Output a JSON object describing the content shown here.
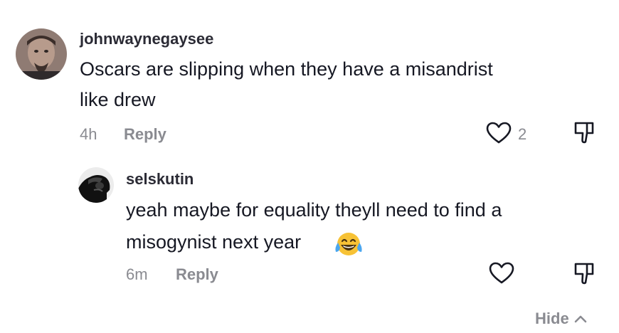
{
  "comment": {
    "username": "johnwaynegaysee",
    "text_line1": "Oscars are slipping when they have a misandrist",
    "text_line2": "like drew",
    "time": "4h",
    "reply_label": "Reply",
    "like_count": "2",
    "icons": [
      "heart-outline-icon",
      "thumbs-down-icon"
    ]
  },
  "reply": {
    "username": "selskutin",
    "text_line1": "yeah maybe for equality theyll need to find a",
    "text_line2": "misogynist next year",
    "emoji": "face-with-tears-of-joy",
    "time": "6m",
    "reply_label": "Reply",
    "icons": [
      "heart-outline-icon",
      "thumbs-down-icon"
    ]
  },
  "hide_label": "Hide",
  "colors": {
    "meta": "#8a8b91",
    "text": "#161823",
    "emoji": "#f7c235"
  }
}
